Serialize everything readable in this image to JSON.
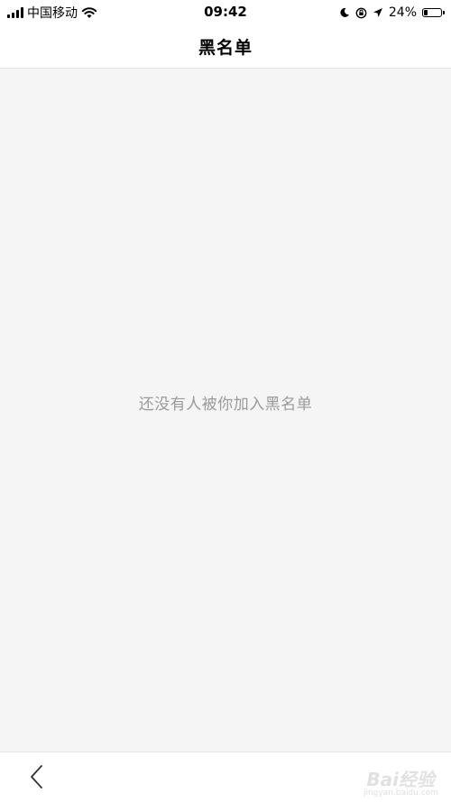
{
  "status_bar": {
    "carrier": "中国移动",
    "time": "09:42",
    "battery_percent": "24%",
    "battery_level": 0.24,
    "icons": [
      "signal-icon",
      "wifi-icon",
      "moon-icon",
      "rotation-lock-icon",
      "location-icon",
      "battery-icon"
    ]
  },
  "header": {
    "title": "黑名单"
  },
  "main": {
    "empty_message": "还没有人被你加入黑名单"
  },
  "footer": {
    "back_icon": "chevron-left-icon",
    "watermark": "Bai经验",
    "watermark_url": "jingyan.baidu.com"
  },
  "colors": {
    "content_bg": "#f5f5f5",
    "empty_text": "#9a9a9a",
    "bar_bg": "#ffffff"
  }
}
